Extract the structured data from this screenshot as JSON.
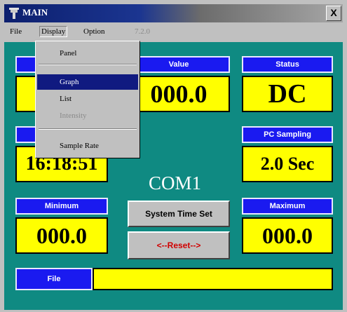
{
  "window": {
    "title": "MAIN",
    "close_label": "X"
  },
  "menubar": {
    "items": [
      "File",
      "Display",
      "Option",
      "7.2.0"
    ]
  },
  "display_menu": {
    "items": [
      {
        "label": "Panel",
        "state": "normal"
      },
      {
        "label": "Graph",
        "state": "selected"
      },
      {
        "label": "List",
        "state": "normal"
      },
      {
        "label": "Intensity",
        "state": "disabled"
      },
      {
        "label": "Sample Rate",
        "state": "normal"
      }
    ]
  },
  "tiles": {
    "value": {
      "label": "Value",
      "value": "000.0"
    },
    "status": {
      "label": "Status",
      "value": "DC"
    },
    "time": {
      "value": "16:18:51"
    },
    "pc_sampling": {
      "label": "PC Sampling",
      "value": "2.0 Sec"
    },
    "minimum": {
      "label": "Minimum",
      "value": "000.0"
    },
    "maximum": {
      "label": "Maximum",
      "value": "000.0"
    },
    "file": {
      "label": "File",
      "value": ""
    }
  },
  "port": "COM1",
  "buttons": {
    "system_time_set": "System Time Set",
    "reset": "<--Reset-->"
  },
  "colors": {
    "panel": "#0f8a82",
    "label_blue": "#1a1af0",
    "value_yellow": "#ffff00",
    "title_blue": "#0c1f6e",
    "menu_selected": "#101a80"
  }
}
